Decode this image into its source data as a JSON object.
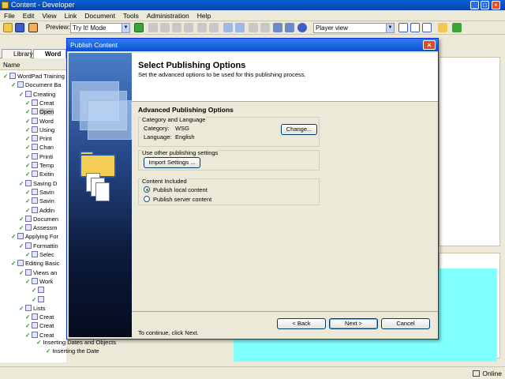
{
  "app": {
    "title": "Content - Developer"
  },
  "menu": [
    "File",
    "Edit",
    "View",
    "Link",
    "Document",
    "Tools",
    "Administration",
    "Help"
  ],
  "toolbar": {
    "preview_label": "Preview:",
    "preview_value": "Try It! Mode",
    "view_value": "Player view"
  },
  "left_pane": {
    "tabs": [
      {
        "label": "Library"
      },
      {
        "label": "Word"
      }
    ],
    "column_header": "Name",
    "tree": [
      {
        "label": "WordPad Training",
        "sel": false
      },
      {
        "label": "Document Ba",
        "sel": false
      },
      {
        "label": "Creating",
        "sel": false
      },
      {
        "label": "Creat",
        "sel": false
      },
      {
        "label": "Open",
        "sel": true
      },
      {
        "label": "Word",
        "sel": false
      },
      {
        "label": "Using",
        "sel": false
      },
      {
        "label": "Print",
        "sel": false
      },
      {
        "label": "Chan",
        "sel": false
      },
      {
        "label": "Printi",
        "sel": false
      },
      {
        "label": "Temp",
        "sel": false
      },
      {
        "label": "Exitin",
        "sel": false
      },
      {
        "label": "Saving D",
        "sel": false
      },
      {
        "label": "Savin",
        "sel": false
      },
      {
        "label": "Savin",
        "sel": false
      },
      {
        "label": "Addin",
        "sel": false
      },
      {
        "label": "Documen",
        "sel": false
      },
      {
        "label": "Assessm",
        "sel": false
      },
      {
        "label": "Applying For",
        "sel": false
      },
      {
        "label": "Formattin",
        "sel": false
      },
      {
        "label": "Selec",
        "sel": false
      },
      {
        "label": "Editing Basic",
        "sel": false
      },
      {
        "label": "Views an",
        "sel": false
      },
      {
        "label": "Work",
        "sel": false
      },
      {
        "label": "",
        "sel": false
      },
      {
        "label": "",
        "sel": false
      },
      {
        "label": "Lists",
        "sel": false
      },
      {
        "label": "Creat",
        "sel": false
      },
      {
        "label": "Creat",
        "sel": false
      },
      {
        "label": "Creat",
        "sel": false
      }
    ],
    "extra_rows": [
      {
        "label": "Inserting Dates and Objects"
      },
      {
        "label": "Inserting the Date"
      }
    ]
  },
  "dialog": {
    "title": "Publish Content",
    "close_glyph": "×",
    "heading": "Select Publishing Options",
    "subheading": "Set the advanced options to be used for this publishing process.",
    "section_title": "Advanced Publishing Options",
    "category_group": {
      "title": "Category and Language",
      "category_label": "Category:",
      "category_value": "WSG",
      "language_label": "Language:",
      "language_value": "English",
      "change_button": "Change..."
    },
    "settings_group": {
      "title": "Use other publishing settings",
      "import_button": "Import Settings ..."
    },
    "content_group": {
      "title": "Content Included",
      "options": [
        {
          "label": "Publish local content",
          "selected": true
        },
        {
          "label": "Publish server content",
          "selected": false
        }
      ]
    },
    "continue_text": "To continue, click Next.",
    "buttons": {
      "back": "< Back",
      "next": "Next >",
      "cancel": "Cancel"
    }
  },
  "status": {
    "online": "Online"
  },
  "colors": {
    "titlebar": "#0a5fd8",
    "cyan_area": "#80ffff",
    "check_green": "#1a9a1a"
  }
}
